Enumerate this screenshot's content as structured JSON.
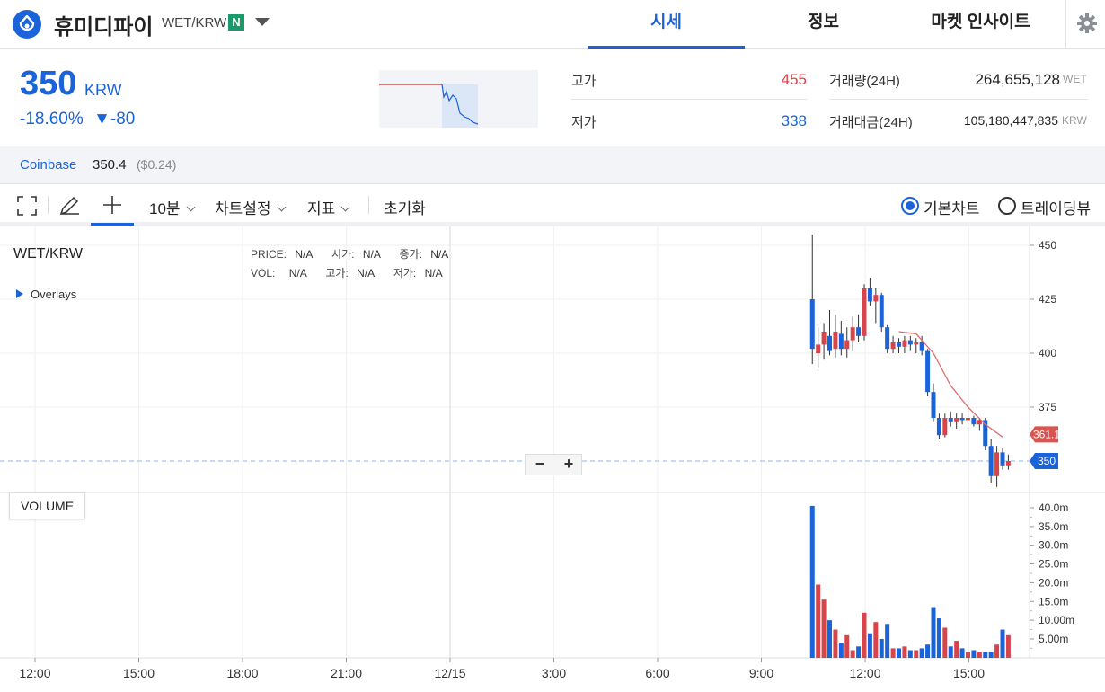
{
  "header": {
    "coin_name": "휴미디파이",
    "pair": "WET/KRW",
    "badge": "N",
    "tabs": [
      {
        "label": "시세",
        "active": true
      },
      {
        "label": "정보",
        "active": false
      },
      {
        "label": "마켓 인사이트",
        "active": false
      }
    ]
  },
  "summary": {
    "price": "350",
    "unit": "KRW",
    "change_pct": "-18.60%",
    "change_abs": "▼-80",
    "high_label": "고가",
    "high_value": "455",
    "low_label": "저가",
    "low_value": "338",
    "volume_label": "거래량(24H)",
    "volume_value": "264,655,128",
    "volume_unit": "WET",
    "amount_label": "거래대금(24H)",
    "amount_value": "105,180,447,835",
    "amount_unit": "KRW"
  },
  "exchange": {
    "name": "Coinbase",
    "price": "350.4",
    "usd": "($0.24)"
  },
  "toolbar": {
    "interval": "10분",
    "chart_settings": "차트설정",
    "indicators": "지표",
    "reset": "초기화",
    "radio_basic": "기본차트",
    "radio_trading": "트레이딩뷰"
  },
  "chart": {
    "symbol": "WET/KRW",
    "overlays": "Overlays",
    "info_row1": [
      [
        "PRICE:",
        "N/A"
      ],
      [
        "시가:",
        "N/A"
      ],
      [
        "종가:",
        "N/A"
      ]
    ],
    "info_row2": [
      [
        "VOL:",
        "N/A"
      ],
      [
        "고가:",
        "N/A"
      ],
      [
        "저가:",
        "N/A"
      ]
    ],
    "volume_label": "VOLUME",
    "price_ticks": [
      "450",
      "425",
      "400",
      "375"
    ],
    "volume_ticks": [
      "40.0m",
      "35.0m",
      "30.0m",
      "25.0m",
      "20.0m",
      "15.0m",
      "10.00m",
      "5.00m"
    ],
    "time_ticks": [
      "12:00",
      "15:00",
      "18:00",
      "21:00",
      "12/15",
      "3:00",
      "6:00",
      "9:00",
      "12:00",
      "15:00"
    ],
    "ma_tag": "361.1",
    "price_tag": "350",
    "zoom_out": "−",
    "zoom_in": "+"
  },
  "colors": {
    "up": "#d9434a",
    "down": "#1b63d9",
    "accent": "#1b63d9"
  },
  "chart_data": {
    "type": "candlestick",
    "title": "WET/KRW",
    "ylim": [
      338,
      455
    ],
    "candles": [
      {
        "t": "10:30",
        "o": 425,
        "h": 455,
        "l": 395,
        "c": 402
      },
      {
        "t": "10:40",
        "o": 400,
        "h": 412,
        "l": 393,
        "c": 404
      },
      {
        "t": "10:50",
        "o": 404,
        "h": 414,
        "l": 397,
        "c": 410
      },
      {
        "t": "11:00",
        "o": 408,
        "h": 420,
        "l": 399,
        "c": 401
      },
      {
        "t": "11:10",
        "o": 402,
        "h": 418,
        "l": 398,
        "c": 410
      },
      {
        "t": "11:20",
        "o": 409,
        "h": 415,
        "l": 399,
        "c": 402
      },
      {
        "t": "11:30",
        "o": 402,
        "h": 412,
        "l": 398,
        "c": 406
      },
      {
        "t": "11:40",
        "o": 406,
        "h": 417,
        "l": 401,
        "c": 412
      },
      {
        "t": "11:50",
        "o": 412,
        "h": 418,
        "l": 405,
        "c": 408
      },
      {
        "t": "12:00",
        "o": 408,
        "h": 432,
        "l": 406,
        "c": 430
      },
      {
        "t": "12:10",
        "o": 430,
        "h": 435,
        "l": 422,
        "c": 424
      },
      {
        "t": "12:20",
        "o": 424,
        "h": 430,
        "l": 414,
        "c": 427
      },
      {
        "t": "12:30",
        "o": 427,
        "h": 428,
        "l": 410,
        "c": 412
      },
      {
        "t": "12:40",
        "o": 412,
        "h": 413,
        "l": 400,
        "c": 402
      },
      {
        "t": "12:50",
        "o": 402,
        "h": 408,
        "l": 400,
        "c": 405
      },
      {
        "t": "13:00",
        "o": 405,
        "h": 407,
        "l": 400,
        "c": 403
      },
      {
        "t": "13:10",
        "o": 403,
        "h": 408,
        "l": 400,
        "c": 406
      },
      {
        "t": "13:20",
        "o": 406,
        "h": 408,
        "l": 401,
        "c": 404
      },
      {
        "t": "13:30",
        "o": 404,
        "h": 407,
        "l": 400,
        "c": 405
      },
      {
        "t": "13:40",
        "o": 405,
        "h": 408,
        "l": 399,
        "c": 401
      },
      {
        "t": "13:50",
        "o": 401,
        "h": 402,
        "l": 380,
        "c": 382
      },
      {
        "t": "14:00",
        "o": 382,
        "h": 386,
        "l": 368,
        "c": 370
      },
      {
        "t": "14:10",
        "o": 370,
        "h": 372,
        "l": 360,
        "c": 362
      },
      {
        "t": "14:20",
        "o": 362,
        "h": 372,
        "l": 361,
        "c": 370
      },
      {
        "t": "14:30",
        "o": 370,
        "h": 373,
        "l": 366,
        "c": 368
      },
      {
        "t": "14:40",
        "o": 368,
        "h": 372,
        "l": 365,
        "c": 370
      },
      {
        "t": "14:50",
        "o": 370,
        "h": 372,
        "l": 367,
        "c": 369
      },
      {
        "t": "15:00",
        "o": 369,
        "h": 372,
        "l": 366,
        "c": 370
      },
      {
        "t": "15:10",
        "o": 370,
        "h": 371,
        "l": 366,
        "c": 367
      },
      {
        "t": "15:20",
        "o": 367,
        "h": 370,
        "l": 364,
        "c": 369
      },
      {
        "t": "15:30",
        "o": 369,
        "h": 370,
        "l": 355,
        "c": 357
      },
      {
        "t": "15:40",
        "o": 357,
        "h": 360,
        "l": 340,
        "c": 343
      },
      {
        "t": "15:50",
        "o": 343,
        "h": 357,
        "l": 338,
        "c": 354
      },
      {
        "t": "16:00",
        "o": 354,
        "h": 356,
        "l": 346,
        "c": 348
      },
      {
        "t": "16:10",
        "o": 348,
        "h": 353,
        "l": 346,
        "c": 350
      }
    ],
    "volume": [
      40.5,
      19.5,
      15.5,
      10,
      7.5,
      4,
      6,
      2,
      3,
      12,
      6.5,
      9.5,
      5,
      9,
      2.5,
      2.5,
      3,
      2,
      2,
      2.5,
      3.5,
      13.5,
      10.5,
      8,
      3,
      4.5,
      2.5,
      1.5,
      2,
      1.5,
      1.5,
      1.5,
      3.5,
      7.5,
      6
    ],
    "moving_average": {
      "name": "MA",
      "points": [
        [
          "13:00",
          410
        ],
        [
          "13:30",
          409
        ],
        [
          "14:00",
          400
        ],
        [
          "14:30",
          385
        ],
        [
          "15:00",
          375
        ],
        [
          "15:30",
          367
        ],
        [
          "16:00",
          361.1
        ]
      ]
    },
    "last_price": 350
  }
}
